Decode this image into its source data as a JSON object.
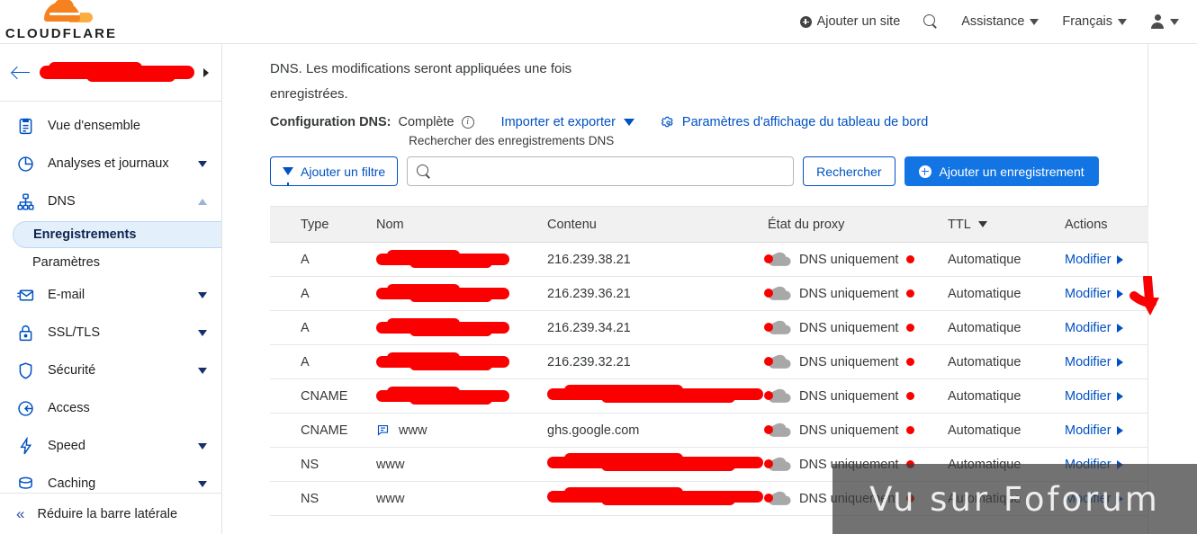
{
  "brand": {
    "name": "CLOUDFLARE",
    "logo_icon": "cloudflare-cloud-icon",
    "accent": "#f6821f"
  },
  "topnav": {
    "add_site": "Ajouter un site",
    "add_site_icon": "plus-circle-icon",
    "search_icon": "search-icon",
    "support": "Assistance",
    "language": "Français",
    "account_icon": "person-icon",
    "caret_icon": "chevron-down-icon"
  },
  "sidebar": {
    "site_name_redacted": "",
    "back_icon": "back-arrow-icon",
    "expand_icon": "chevron-right-icon",
    "items": [
      {
        "label": "Vue d'ensemble",
        "icon": "clipboard-icon",
        "expandable": false
      },
      {
        "label": "Analyses et journaux",
        "icon": "pie-chart-icon",
        "expandable": true
      },
      {
        "label": "DNS",
        "icon": "sitemap-icon",
        "expandable": true,
        "expanded": true
      },
      {
        "label": "E-mail",
        "icon": "envelope-icon",
        "expandable": true
      },
      {
        "label": "SSL/TLS",
        "icon": "lock-icon",
        "expandable": true
      },
      {
        "label": "Sécurité",
        "icon": "shield-icon",
        "expandable": true
      },
      {
        "label": "Access",
        "icon": "access-arrow-icon",
        "expandable": false
      },
      {
        "label": "Speed",
        "icon": "bolt-icon",
        "expandable": true
      },
      {
        "label": "Caching",
        "icon": "database-icon",
        "expandable": true
      }
    ],
    "dns_subitems": [
      {
        "label": "Enregistrements",
        "active": true
      },
      {
        "label": "Paramètres",
        "active": false
      }
    ],
    "collapse": {
      "label": "Réduire la barre latérale",
      "icon": "double-chevron-left-icon"
    }
  },
  "main": {
    "intro_line1": "DNS. Les modifications seront appliquées une fois",
    "intro_line2": "enregistrées.",
    "config_label": "Configuration DNS:",
    "config_value": "Complète",
    "info_icon": "info-circle-icon",
    "import_export": "Importer et exporter",
    "import_export_caret": "chevron-down-icon",
    "dashboard_settings": "Paramètres d'affichage du tableau de bord",
    "gear_icon": "gear-icon"
  },
  "toolbar": {
    "filter_label": "Ajouter un filtre",
    "filter_icon": "funnel-icon",
    "search_label": "Rechercher des enregistrements DNS",
    "search_value": "",
    "search_placeholder": "",
    "search_icon": "search-icon",
    "search_button": "Rechercher",
    "add_record": "Ajouter un enregistrement",
    "add_record_icon": "plus-circle-icon"
  },
  "table": {
    "headers": [
      "Type",
      "Nom",
      "Contenu",
      "État du proxy",
      "TTL",
      "Actions"
    ],
    "ttl_sort_icon": "chevron-down-icon",
    "proxy_off_icon": "cloud-dns-only-icon",
    "comment_icon": "note-icon",
    "edit_label": "Modifier",
    "edit_icon": "triangle-right-icon",
    "rows": [
      {
        "type": "A",
        "name": "",
        "name_redacted": true,
        "content": "216.239.38.21",
        "content_redacted": false,
        "proxy": "DNS uniquement",
        "ttl": "Automatique",
        "action": "Modifier",
        "has_comment": false
      },
      {
        "type": "A",
        "name": "",
        "name_redacted": true,
        "content": "216.239.36.21",
        "content_redacted": false,
        "proxy": "DNS uniquement",
        "ttl": "Automatique",
        "action": "Modifier",
        "has_comment": false
      },
      {
        "type": "A",
        "name": "",
        "name_redacted": true,
        "content": "216.239.34.21",
        "content_redacted": false,
        "proxy": "DNS uniquement",
        "ttl": "Automatique",
        "action": "Modifier",
        "has_comment": false
      },
      {
        "type": "A",
        "name": "",
        "name_redacted": true,
        "content": "216.239.32.21",
        "content_redacted": false,
        "proxy": "DNS uniquement",
        "ttl": "Automatique",
        "action": "Modifier",
        "has_comment": false
      },
      {
        "type": "CNAME",
        "name": "",
        "name_redacted": true,
        "content": "",
        "content_redacted": true,
        "proxy": "DNS uniquement",
        "ttl": "Automatique",
        "action": "Modifier",
        "has_comment": false
      },
      {
        "type": "CNAME",
        "name": "www",
        "name_redacted": false,
        "content": "ghs.google.com",
        "content_redacted": false,
        "proxy": "DNS uniquement",
        "ttl": "Automatique",
        "action": "Modifier",
        "has_comment": true
      },
      {
        "type": "NS",
        "name": "www",
        "name_redacted": false,
        "content": "",
        "content_redacted": true,
        "proxy": "DNS uniquement",
        "ttl": "Automatique",
        "action": "Modifier",
        "has_comment": false
      },
      {
        "type": "NS",
        "name": "www",
        "name_redacted": false,
        "content": "",
        "content_redacted": true,
        "proxy": "DNS uniquement",
        "ttl": "Automatique",
        "action": "Modifier",
        "has_comment": false
      }
    ]
  },
  "annotations": {
    "arrow_color": "#fa0000",
    "arrow_target": "État du proxy",
    "redaction_color": "#fa0000"
  },
  "watermark": {
    "text": "Vu sur Foforum"
  }
}
